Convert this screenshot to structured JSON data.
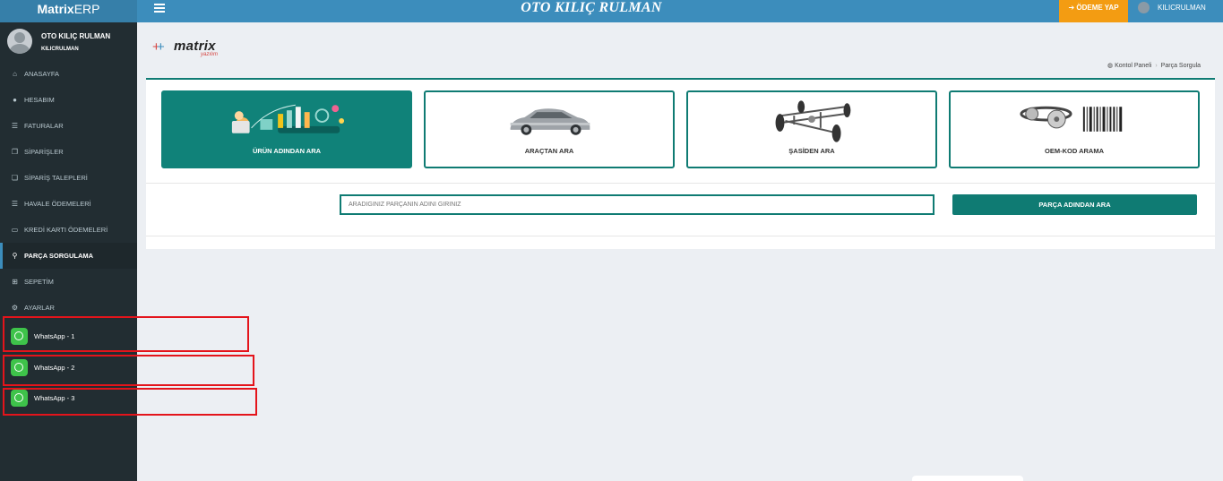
{
  "header": {
    "brand_bold": "Matrix",
    "brand_light": "ERP",
    "company": "OTO KILIÇ RULMAN",
    "pay_label": "➔ ÖDEME YAP",
    "username": "KILICRULMAN"
  },
  "user_panel": {
    "name": "OTO KILIÇ RULMAN",
    "subname": "KILICRULMAN"
  },
  "sidebar": {
    "items": [
      {
        "label": "ANASAYFA",
        "icon": "home-icon"
      },
      {
        "label": "HESABIM",
        "icon": "user-circle-icon"
      },
      {
        "label": "FATURALAR",
        "icon": "list-icon"
      },
      {
        "label": "SİPARİŞLER",
        "icon": "copy-icon"
      },
      {
        "label": "SİPARİŞ TALEPLERİ",
        "icon": "files-icon"
      },
      {
        "label": "HAVALE ÖDEMELERİ",
        "icon": "list-icon"
      },
      {
        "label": "KREDİ KARTI ÖDEMELERİ",
        "icon": "credit-card-icon"
      },
      {
        "label": "PARÇA SORGULAMA",
        "icon": "search-icon"
      },
      {
        "label": "SEPETİM",
        "icon": "basket-icon"
      },
      {
        "label": "AYARLAR",
        "icon": "cogs-icon"
      }
    ],
    "whatsapp": [
      {
        "label": "WhatsApp - 1"
      },
      {
        "label": "WhatsApp - 2"
      },
      {
        "label": "WhatsApp - 3"
      }
    ]
  },
  "logo": {
    "word": "matrix",
    "sub": "yazılım"
  },
  "breadcrumb": {
    "home": "Kontol Paneli",
    "current": "Parça Sorgula"
  },
  "cards": [
    {
      "label": "ÜRÜN ADINDAN ARA"
    },
    {
      "label": "ARAÇTAN ARA"
    },
    {
      "label": "ŞASİDEN ARA"
    },
    {
      "label": "OEM-KOD ARAMA"
    }
  ],
  "search": {
    "placeholder": "ARADIĞINIZ PARÇANIN ADINI GİRİNİZ",
    "button": "PARÇA ADINDAN ARA"
  },
  "colors": {
    "accent": "#0f7b73",
    "topbar": "#3c8dbc",
    "sidebar": "#222d32",
    "pay_button": "#f39c12",
    "highlight": "#e4141b"
  }
}
